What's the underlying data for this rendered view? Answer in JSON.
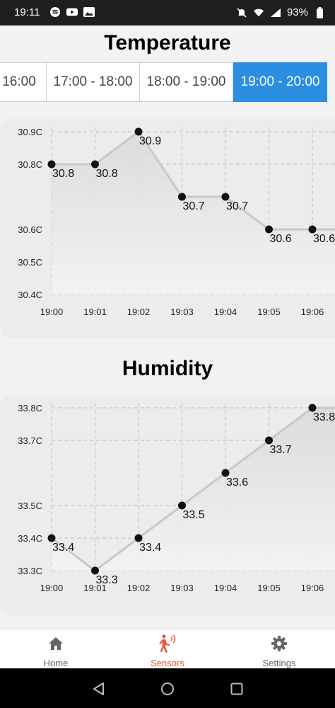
{
  "status_bar": {
    "time": "19:11",
    "battery": "93%",
    "icons": [
      "spotify-icon",
      "youtube-icon",
      "image-icon",
      "mute-icon",
      "wifi-icon",
      "signal-icon",
      "battery-icon"
    ]
  },
  "temperature": {
    "title": "Temperature",
    "tabs": [
      {
        "label": "16:00",
        "active": false
      },
      {
        "label": "17:00 - 18:00",
        "active": false
      },
      {
        "label": "18:00 - 19:00",
        "active": false
      },
      {
        "label": "19:00 - 20:00",
        "active": true
      }
    ]
  },
  "humidity": {
    "title": "Humidity"
  },
  "chart_data": [
    {
      "type": "line",
      "title": "Temperature",
      "x": [
        "19:00",
        "19:01",
        "19:02",
        "19:03",
        "19:04",
        "19:05",
        "19:06"
      ],
      "series": [
        {
          "values": [
            30.8,
            30.8,
            30.9,
            30.7,
            30.7,
            30.6,
            30.6
          ]
        }
      ],
      "data_labels": [
        "30.8",
        "30.8",
        "30.9",
        "30.7",
        "30.7",
        "30.6",
        "30.6"
      ],
      "y_ticks": [
        "30.9C",
        "30.8C",
        "30.6C",
        "30.5C",
        "30.4C"
      ],
      "y_tick_values": [
        30.9,
        30.8,
        30.6,
        30.5,
        30.4
      ],
      "ylim": [
        30.4,
        30.9
      ],
      "grid": true,
      "line_color": "#c8c8c8",
      "point_color": "#111111"
    },
    {
      "type": "line",
      "title": "Humidity",
      "x": [
        "19:00",
        "19:01",
        "19:02",
        "19:03",
        "19:04",
        "19:05",
        "19:06"
      ],
      "series": [
        {
          "values": [
            33.4,
            33.3,
            33.4,
            33.5,
            33.6,
            33.7,
            33.8
          ]
        }
      ],
      "data_labels": [
        "33.4",
        "33.3",
        "33.4",
        "33.5",
        "33.6",
        "33.7",
        "33.8"
      ],
      "y_ticks": [
        "33.8C",
        "33.7C",
        "33.5C",
        "33.4C",
        "33.3C"
      ],
      "y_tick_values": [
        33.8,
        33.7,
        33.5,
        33.4,
        33.3
      ],
      "ylim": [
        33.3,
        33.8
      ],
      "grid": true,
      "line_color": "#c8c8c8",
      "point_color": "#111111"
    }
  ],
  "bottom_nav": {
    "items": [
      {
        "label": "Home",
        "icon": "home-icon",
        "active": false
      },
      {
        "label": "Sensors",
        "icon": "sensors-icon",
        "active": true
      },
      {
        "label": "Settings",
        "icon": "gear-icon",
        "active": false
      }
    ]
  },
  "colors": {
    "accent": "#2a8ee3",
    "active_nav": "#e8563d",
    "inactive_nav": "#666666"
  }
}
